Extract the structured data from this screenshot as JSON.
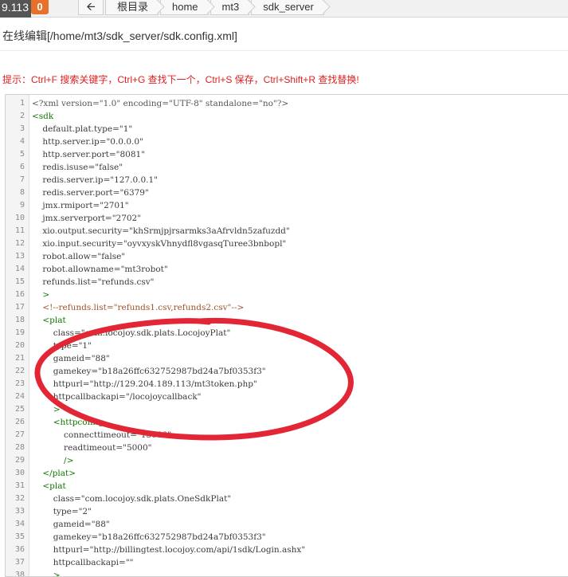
{
  "topbar": {
    "ip_fragment": "9.113",
    "badge": "0",
    "back_icon": "back-arrow-icon",
    "crumbs": [
      "根目录",
      "home",
      "mt3",
      "sdk_server"
    ]
  },
  "editor_title": "在线编辑[/home/mt3/sdk_server/sdk.config.xml]",
  "hint": "提示：Ctrl+F 搜索关键字，Ctrl+G 查找下一个，Ctrl+S 保存，Ctrl+Shift+R 查找替换!",
  "annotation_color": "#e32636",
  "code_lines": [
    {
      "n": "1",
      "t": "<?xml version=\"1.0\" encoding=\"UTF-8\" standalone=\"no\"?>",
      "k": "meta"
    },
    {
      "n": "2",
      "t": "<sdk",
      "k": "tag"
    },
    {
      "n": "3",
      "t": "    default.plat.type=\"1\"",
      "k": "attr"
    },
    {
      "n": "4",
      "t": "    http.server.ip=\"0.0.0.0\"",
      "k": "attr"
    },
    {
      "n": "5",
      "t": "    http.server.port=\"8081\"",
      "k": "attr"
    },
    {
      "n": "6",
      "t": "    redis.isuse=\"false\"",
      "k": "attr"
    },
    {
      "n": "7",
      "t": "    redis.server.ip=\"127.0.0.1\"",
      "k": "attr"
    },
    {
      "n": "8",
      "t": "    redis.server.port=\"6379\"",
      "k": "attr"
    },
    {
      "n": "9",
      "t": "    jmx.rmiport=\"2701\"",
      "k": "attr"
    },
    {
      "n": "10",
      "t": "    jmx.serverport=\"2702\"",
      "k": "attr"
    },
    {
      "n": "11",
      "t": "    xio.output.security=\"khSrmjpjrsarmks3aAfrvldn5zafuzdd\"",
      "k": "attr"
    },
    {
      "n": "12",
      "t": "    xio.input.security=\"oyvxyskVhnydfl8vgasqTuree3bnbopl\"",
      "k": "attr"
    },
    {
      "n": "13",
      "t": "    robot.allow=\"false\"",
      "k": "attr"
    },
    {
      "n": "14",
      "t": "    robot.allowname=\"mt3robot\"",
      "k": "attr"
    },
    {
      "n": "15",
      "t": "    refunds.list=\"refunds.csv\"",
      "k": "attr"
    },
    {
      "n": "16",
      "t": "    >",
      "k": "tag"
    },
    {
      "n": "17",
      "t": "    <!--refunds.list=\"refunds1.csv,refunds2.csv\"-->",
      "k": "comment"
    },
    {
      "n": "18",
      "t": "    <plat",
      "k": "tag"
    },
    {
      "n": "19",
      "t": "        class=\"com.locojoy.sdk.plats.LocojoyPlat\"",
      "k": "attr"
    },
    {
      "n": "20",
      "t": "        type=\"1\"",
      "k": "attr"
    },
    {
      "n": "21",
      "t": "        gameid=\"88\"",
      "k": "attr"
    },
    {
      "n": "22",
      "t": "        gamekey=\"b18a26ffc632752987bd24a7bf0353f3\"",
      "k": "attr"
    },
    {
      "n": "23",
      "t": "        httpurl=\"http://129.204.189.113/mt3token.php\"",
      "k": "attr"
    },
    {
      "n": "24",
      "t": "        httpcallbackapi=\"/locojoycallback\"",
      "k": "attr"
    },
    {
      "n": "25",
      "t": "        >",
      "k": "tag"
    },
    {
      "n": "26",
      "t": "        <httpconfig",
      "k": "tag"
    },
    {
      "n": "27",
      "t": "            connecttimeout=\"15000\"",
      "k": "attr"
    },
    {
      "n": "28",
      "t": "            readtimeout=\"5000\"",
      "k": "attr"
    },
    {
      "n": "29",
      "t": "            />",
      "k": "tag"
    },
    {
      "n": "30",
      "t": "    </plat>",
      "k": "tag"
    },
    {
      "n": "31",
      "t": "    <plat",
      "k": "tag"
    },
    {
      "n": "32",
      "t": "        class=\"com.locojoy.sdk.plats.OneSdkPlat\"",
      "k": "attr"
    },
    {
      "n": "33",
      "t": "        type=\"2\"",
      "k": "attr"
    },
    {
      "n": "34",
      "t": "        gameid=\"88\"",
      "k": "attr"
    },
    {
      "n": "35",
      "t": "        gamekey=\"b18a26ffc632752987bd24a7bf0353f3\"",
      "k": "attr"
    },
    {
      "n": "36",
      "t": "        httpurl=\"http://billingtest.locojoy.com/api/1sdk/Login.ashx\"",
      "k": "attr"
    },
    {
      "n": "37",
      "t": "        httpcallbackapi=\"\"",
      "k": "attr"
    },
    {
      "n": "38",
      "t": "        >",
      "k": "tag"
    }
  ]
}
